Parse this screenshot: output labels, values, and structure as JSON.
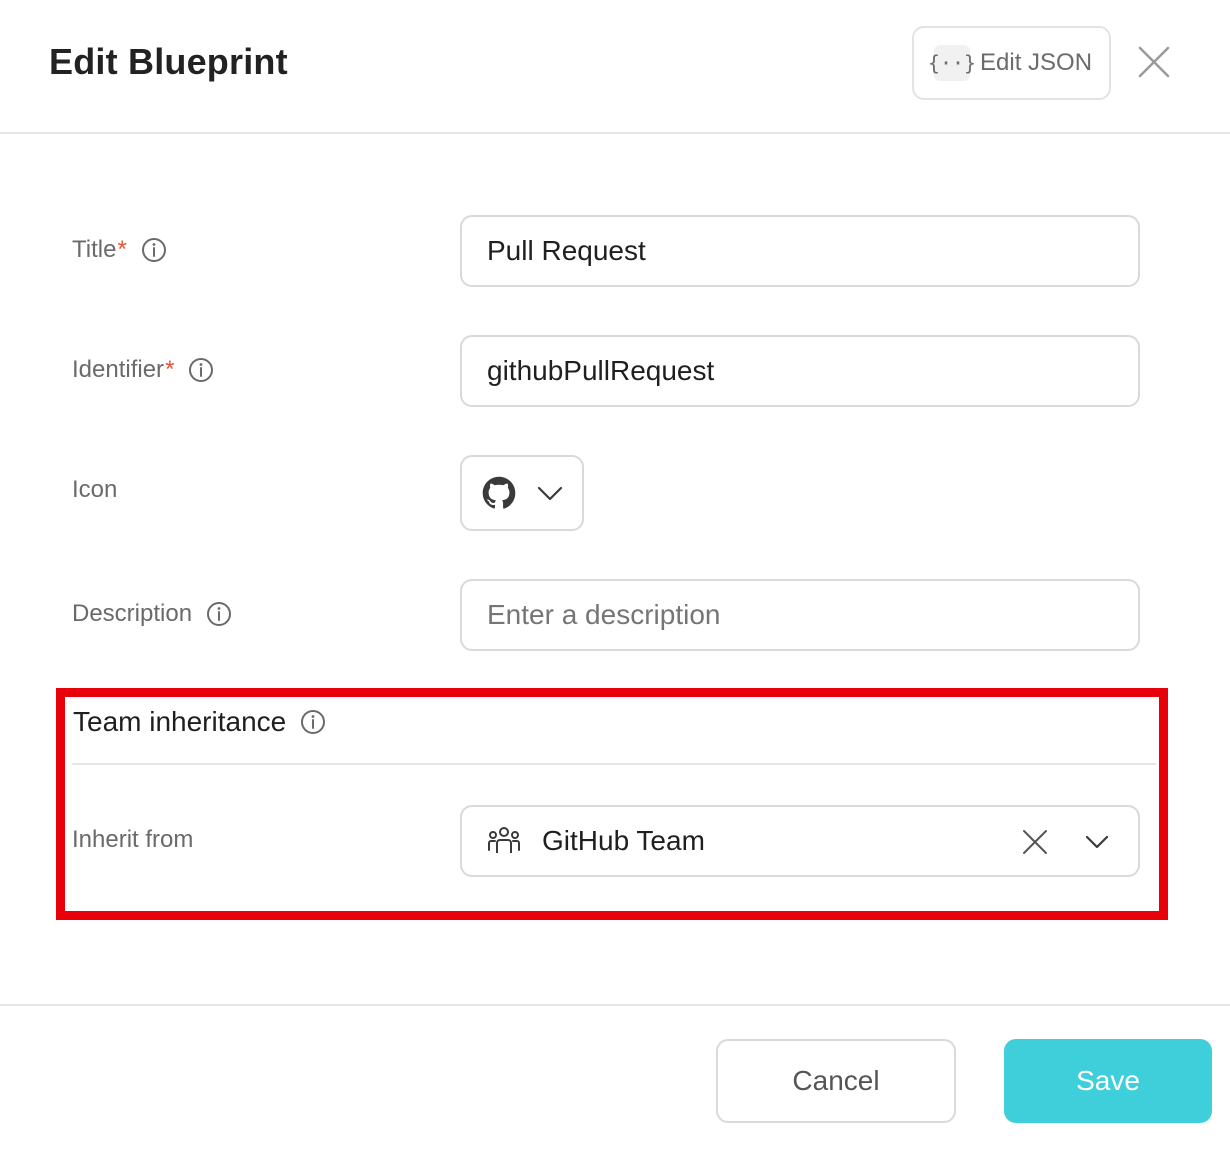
{
  "dialog": {
    "title": "Edit Blueprint",
    "edit_json_label": "Edit JSON",
    "edit_json_icon": "{··}"
  },
  "form": {
    "title": {
      "label": "Title",
      "required_mark": "*",
      "value": "Pull Request"
    },
    "identifier": {
      "label": "Identifier",
      "required_mark": "*",
      "value": "githubPullRequest"
    },
    "icon": {
      "label": "Icon",
      "selected_icon": "github-icon"
    },
    "description": {
      "label": "Description",
      "placeholder": "Enter a description",
      "value": ""
    }
  },
  "team_inheritance": {
    "section_title": "Team inheritance",
    "inherit_from_label": "Inherit from",
    "selected_value": "GitHub Team",
    "selected_icon": "team-icon"
  },
  "footer": {
    "cancel_label": "Cancel",
    "save_label": "Save"
  },
  "colors": {
    "accent": "#3ecfda",
    "required": "#e8542f",
    "highlight": "#e8000b"
  }
}
